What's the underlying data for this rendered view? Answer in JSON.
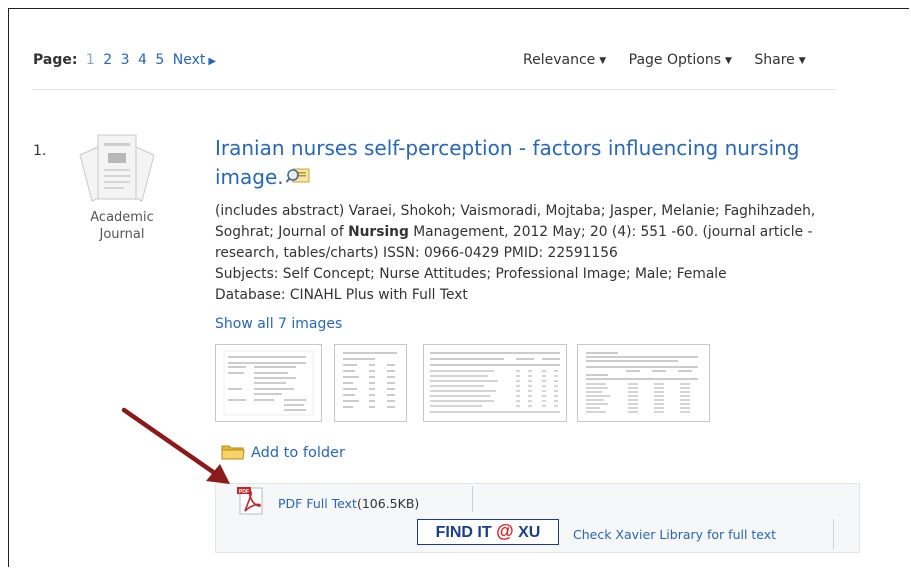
{
  "pager": {
    "label": "Page:",
    "pages": [
      "1",
      "2",
      "3",
      "4",
      "5"
    ],
    "next": "Next"
  },
  "options": {
    "relevance": "Relevance",
    "page_options": "Page Options",
    "share": "Share"
  },
  "result": {
    "number": "1.",
    "pub_type_line1": "Academic",
    "pub_type_line2": "Journal",
    "title": "Iranian nurses self-perception - factors influencing nursing image.",
    "authors_prefix": "(includes abstract) Varaei, Shokoh; Vaismoradi, Mojtaba; Jasper, Melanie; Faghihzadeh, Soghrat; Journal of ",
    "journal_bold": "Nursing",
    "source_rest": " Management, 2012 May; 20 (4): 551 -60. (journal article - research, tables/charts) ISSN: 0966-0429 PMID: 22591156",
    "subjects": "Subjects: Self Concept; Nurse Attitudes; Professional Image; Male; Female",
    "database": "Database: CINAHL Plus with Full Text",
    "show_images": "Show all 7 images",
    "add_to_folder": "Add to folder",
    "pdf_label": "PDF Full Text",
    "pdf_size": "(106.5KB)",
    "findit_prefix": "FIND IT",
    "findit_at": "@",
    "findit_suffix": "XU",
    "check_library": "Check Xavier Library for full text"
  },
  "colors": {
    "link": "#2966b8",
    "arrow": "#8b1a1a",
    "findit_border": "#1c3d8a",
    "findit_at": "#d8232a"
  }
}
